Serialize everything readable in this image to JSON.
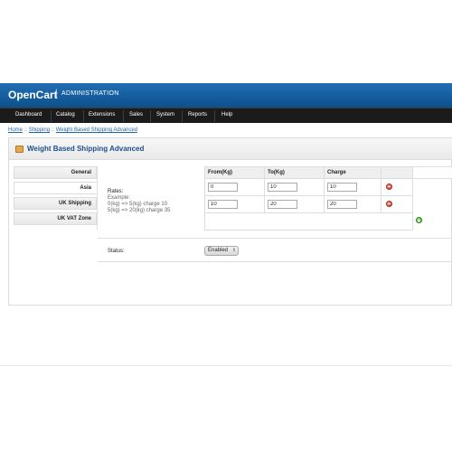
{
  "header": {
    "logo": "OpenCart",
    "separator": "|",
    "subtitle": "ADMINISTRATION"
  },
  "menu": {
    "items": [
      "Dashboard",
      "Catalog",
      "Extensions",
      "Sales",
      "System",
      "Reports",
      "Help"
    ]
  },
  "breadcrumb": {
    "items": [
      "Home",
      "Shipping",
      "Weight Based Shipping Advanced"
    ],
    "separator": "::"
  },
  "box": {
    "title": "Weight Based Shipping Advanced"
  },
  "tabs": [
    "General",
    "Asia",
    "UK Shipping",
    "UK VAT Zone"
  ],
  "active_tab": "Asia",
  "rates": {
    "label": "Rates:",
    "help": [
      "Example:",
      "0(kg) => 5(kg) charge 10",
      "5(kg) => 20(kg) charge 35"
    ],
    "columns": [
      "From(Kg)",
      "To(Kg)",
      "Charge"
    ],
    "rows": [
      {
        "from": "0",
        "to": "10",
        "charge": "10"
      },
      {
        "from": "10",
        "to": "20",
        "charge": "20"
      }
    ]
  },
  "status": {
    "label": "Status:",
    "value": "Enabled"
  },
  "colors": {
    "header_blue": "#1f6fb4",
    "menu_dark": "#1b1b1b",
    "title_blue": "#1e4f8a",
    "remove_red": "#d13c24",
    "add_green": "#3ca61f"
  },
  "icons": {
    "box": "module-box-icon",
    "remove": "remove-row-icon",
    "add": "add-row-icon"
  }
}
